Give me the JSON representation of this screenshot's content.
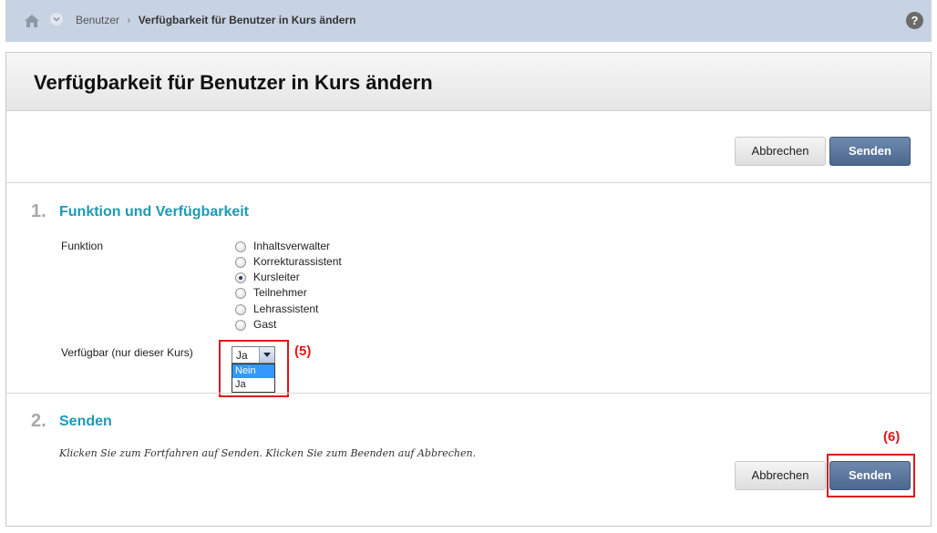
{
  "breadcrumb": {
    "parent": "Benutzer",
    "separator": "›",
    "current": "Verfügbarkeit für Benutzer in Kurs ändern"
  },
  "help": {
    "label": "?"
  },
  "page": {
    "title": "Verfügbarkeit für Benutzer in Kurs ändern"
  },
  "top_buttons": {
    "cancel": "Abbrechen",
    "submit": "Senden"
  },
  "step1": {
    "number": "1.",
    "title": "Funktion und Verfügbarkeit",
    "role_label": "Funktion",
    "roles": [
      {
        "label": "Inhaltsverwalter",
        "checked": false
      },
      {
        "label": "Korrekturassistent",
        "checked": false
      },
      {
        "label": "Kursleiter",
        "checked": true
      },
      {
        "label": "Teilnehmer",
        "checked": false
      },
      {
        "label": "Lehrassistent",
        "checked": false
      },
      {
        "label": "Gast",
        "checked": false
      }
    ],
    "available_label": "Verfügbar (nur dieser Kurs)",
    "available_selected": "Ja",
    "available_options": [
      "Nein",
      "Ja"
    ],
    "available_highlighted": "Nein"
  },
  "annotations": {
    "select_marker": "(5)",
    "submit_marker": "(6)",
    "color": "#e0161b"
  },
  "step2": {
    "number": "2.",
    "title": "Senden",
    "instructions": "Klicken Sie zum Fortfahren auf Senden. Klicken Sie zum Beenden auf Abbrechen.",
    "cancel": "Abbrechen",
    "submit": "Senden"
  },
  "colors": {
    "accent": "#1d9ab3",
    "submit_button": "#4b6890",
    "topbar": "#c7d3e2",
    "highlight": "#e0161b"
  }
}
